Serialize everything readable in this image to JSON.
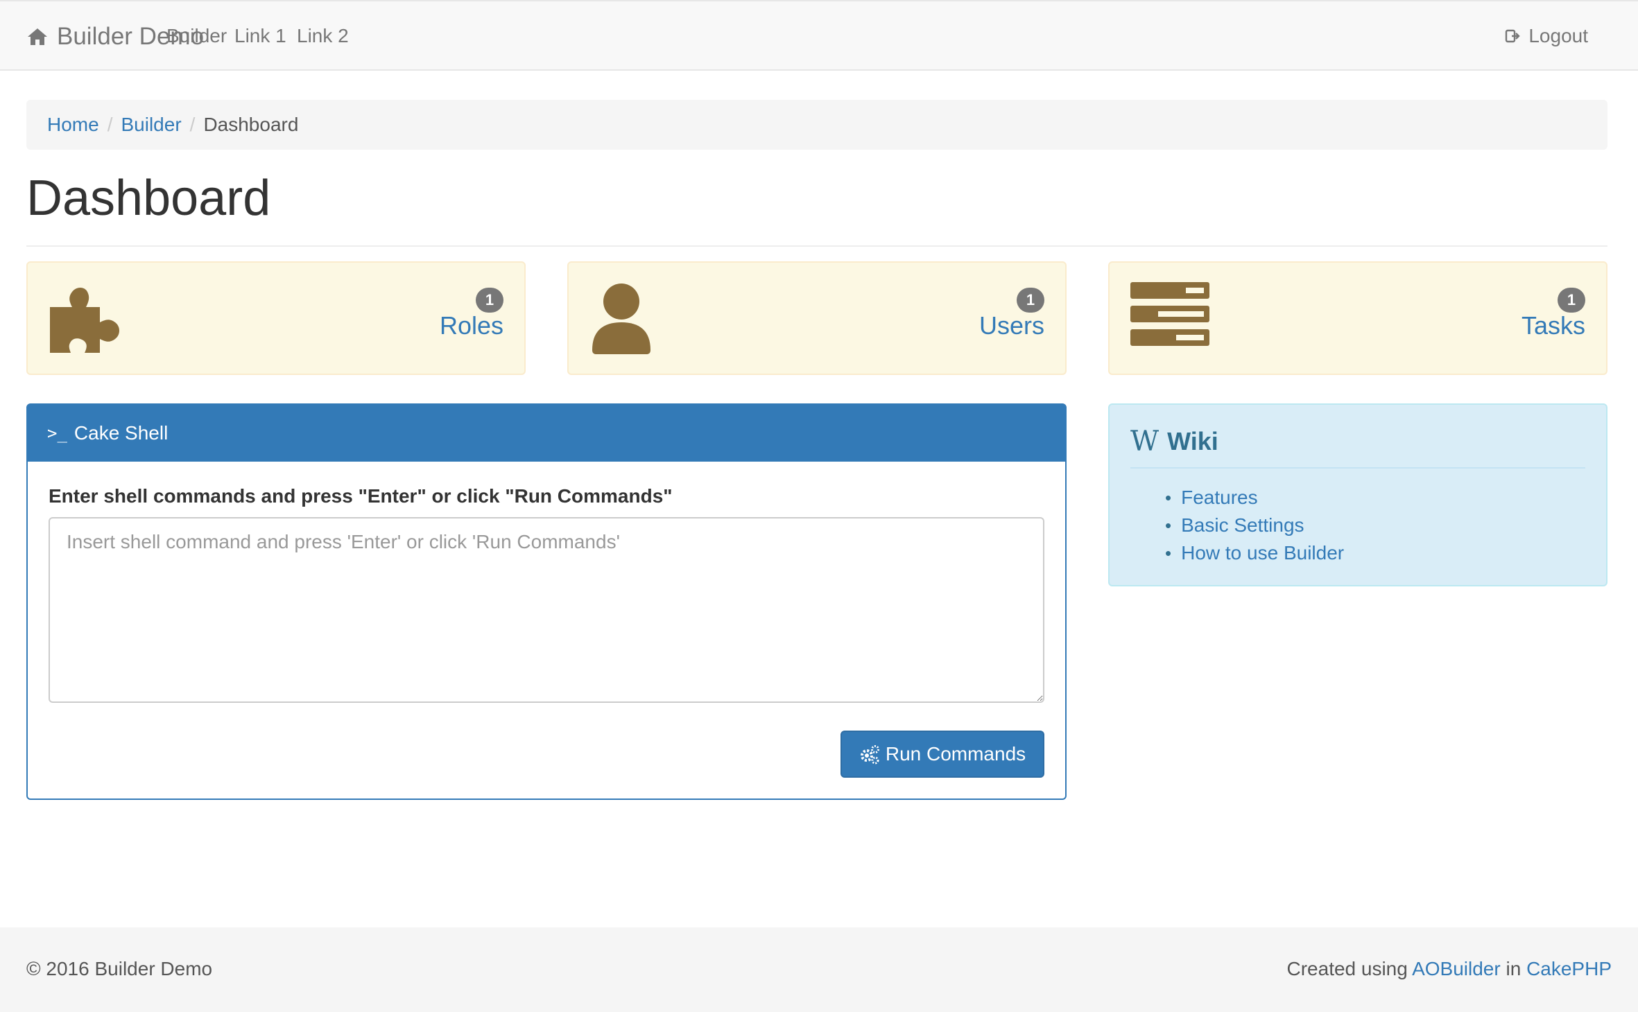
{
  "navbar": {
    "brand": "Builder Demo",
    "links": [
      "Builder",
      "Link 1",
      "Link 2"
    ],
    "logout": "Logout"
  },
  "breadcrumb": {
    "items": [
      "Home",
      "Builder"
    ],
    "active": "Dashboard"
  },
  "page": {
    "title": "Dashboard"
  },
  "stats": [
    {
      "label": "Roles",
      "count": "1",
      "icon": "puzzle-icon"
    },
    {
      "label": "Users",
      "count": "1",
      "icon": "user-icon"
    },
    {
      "label": "Tasks",
      "count": "1",
      "icon": "tasks-icon"
    }
  ],
  "shell": {
    "heading": "Cake Shell",
    "label": "Enter shell commands and press \"Enter\" or click \"Run Commands\"",
    "placeholder": "Insert shell command and press 'Enter' or click 'Run Commands'",
    "value": "",
    "button": "Run Commands"
  },
  "wiki": {
    "title": "Wiki",
    "links": [
      "Features",
      "Basic Settings",
      "How to use Builder"
    ]
  },
  "footer": {
    "copyright": "© 2016 Builder Demo",
    "created_prefix": "Created using",
    "aobuilder": "AOBuilder",
    "in": "in",
    "cakephp": "CakePHP"
  },
  "colors": {
    "primary": "#337ab7",
    "warning_bg": "#fcf8e3",
    "icon_brown": "#8a6d3b",
    "info_bg": "#d9edf7"
  }
}
